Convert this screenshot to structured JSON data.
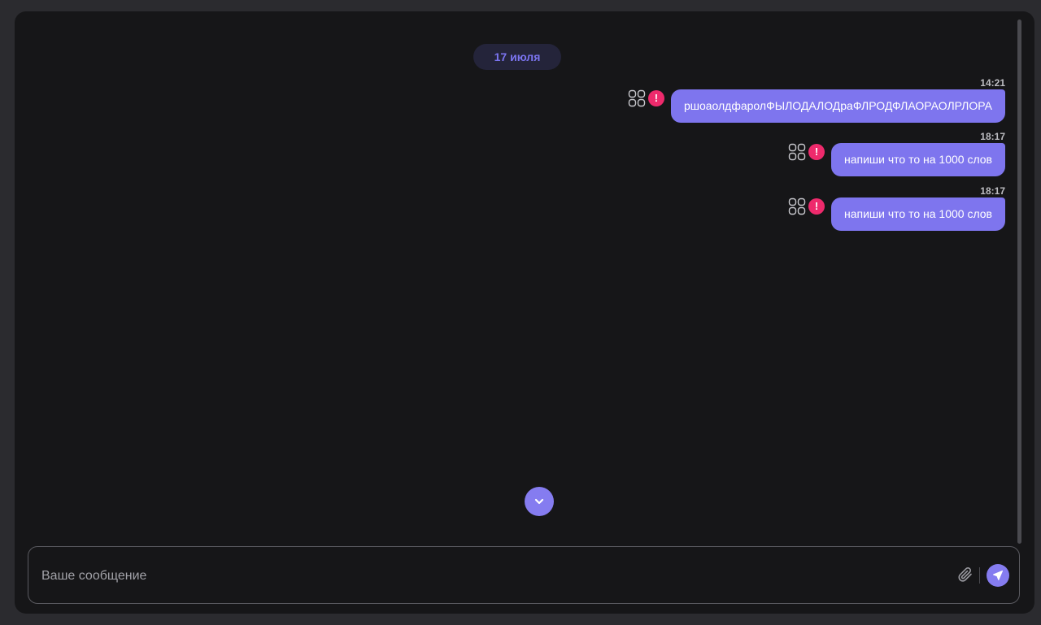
{
  "chat": {
    "date_label": "17 июля",
    "messages": [
      {
        "time": "14:21",
        "text": "ршоаолдфаролФЫЛОДАЛОДраФЛРОДФЛАОРАОЛРЛОРА",
        "status": "error"
      },
      {
        "time": "18:17",
        "text": "напиши что то на 1000 слов",
        "status": "error"
      },
      {
        "time": "18:17",
        "text": "напиши что то на 1000 слов",
        "status": "error"
      }
    ]
  },
  "composer": {
    "placeholder": "Ваше сообщение",
    "value": ""
  },
  "icons": {
    "message_menu": "grid-icon",
    "message_status": "error-icon",
    "error_glyph": "!",
    "scroll_down": "chevron-down-icon",
    "attach": "paperclip-icon",
    "send": "send-icon"
  },
  "colors": {
    "background": "#161618",
    "frame": "#2b2b2f",
    "bubble": "#7e75ee",
    "accent": "#857cf0",
    "date_pill_bg": "#24243a",
    "date_pill_text": "#7b74f0",
    "error": "#ee2a6c"
  }
}
